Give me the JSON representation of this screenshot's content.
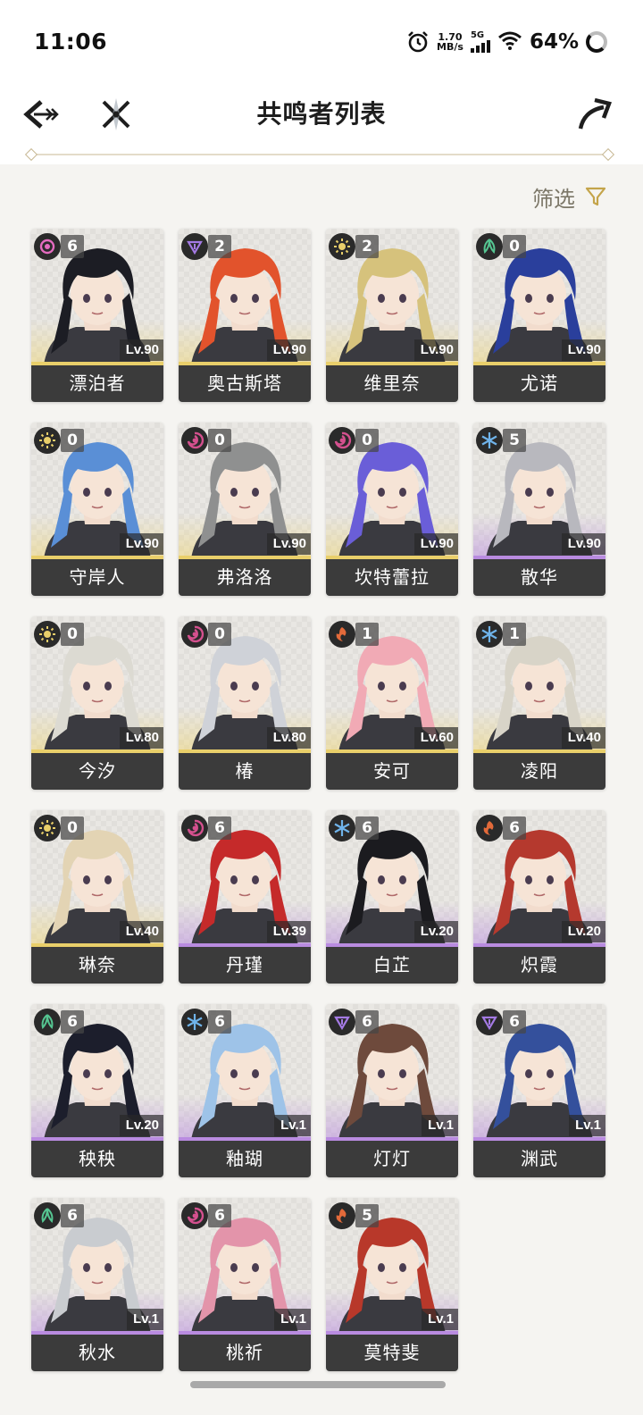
{
  "status_bar": {
    "time": "11:06",
    "net_speed_value": "1.70",
    "net_speed_unit": "MB/s",
    "network_type": "5G",
    "battery": "64%"
  },
  "header": {
    "title": "共鸣者列表"
  },
  "filter": {
    "label": "筛选"
  },
  "colors": {
    "gold_rarity": "#e9cf6a",
    "purple_rarity": "#b98be0",
    "name_bar": "#3b3b3b",
    "accent": "#c4a44a"
  },
  "characters": [
    {
      "name": "漂泊者",
      "level": "Lv.90",
      "chain": "6",
      "element": "spectro-havoc",
      "rarity": "gold",
      "hair": "#1c1d24"
    },
    {
      "name": "奥古斯塔",
      "level": "Lv.90",
      "chain": "2",
      "element": "electro",
      "rarity": "gold",
      "hair": "#e2532c"
    },
    {
      "name": "维里奈",
      "level": "Lv.90",
      "chain": "2",
      "element": "spectro",
      "rarity": "gold",
      "hair": "#d6c27c"
    },
    {
      "name": "尤诺",
      "level": "Lv.90",
      "chain": "0",
      "element": "aero",
      "rarity": "gold",
      "hair": "#2a3f9c"
    },
    {
      "name": "守岸人",
      "level": "Lv.90",
      "chain": "0",
      "element": "spectro",
      "rarity": "gold",
      "hair": "#5a8fd6"
    },
    {
      "name": "弗洛洛",
      "level": "Lv.90",
      "chain": "0",
      "element": "havoc",
      "rarity": "gold",
      "hair": "#8f9090"
    },
    {
      "name": "坎特蕾拉",
      "level": "Lv.90",
      "chain": "0",
      "element": "havoc",
      "rarity": "gold",
      "hair": "#6a5ed8"
    },
    {
      "name": "散华",
      "level": "Lv.90",
      "chain": "5",
      "element": "glacio",
      "rarity": "purple",
      "hair": "#b8b8be"
    },
    {
      "name": "今汐",
      "level": "Lv.80",
      "chain": "0",
      "element": "spectro",
      "rarity": "gold",
      "hair": "#dcdad2"
    },
    {
      "name": "椿",
      "level": "Lv.80",
      "chain": "0",
      "element": "havoc",
      "rarity": "gold",
      "hair": "#cfd2d8"
    },
    {
      "name": "安可",
      "level": "Lv.60",
      "chain": "1",
      "element": "fusion",
      "rarity": "gold",
      "hair": "#f1aab5"
    },
    {
      "name": "凌阳",
      "level": "Lv.40",
      "chain": "1",
      "element": "glacio",
      "rarity": "gold",
      "hair": "#d8d4c8"
    },
    {
      "name": "琳奈",
      "level": "Lv.40",
      "chain": "0",
      "element": "spectro",
      "rarity": "gold",
      "hair": "#e3d4b4"
    },
    {
      "name": "丹瑾",
      "level": "Lv.39",
      "chain": "6",
      "element": "havoc",
      "rarity": "purple",
      "hair": "#c52a2a"
    },
    {
      "name": "白芷",
      "level": "Lv.20",
      "chain": "6",
      "element": "glacio",
      "rarity": "purple",
      "hair": "#1b1b1f"
    },
    {
      "name": "炽霞",
      "level": "Lv.20",
      "chain": "6",
      "element": "fusion",
      "rarity": "purple",
      "hair": "#b5392e"
    },
    {
      "name": "秧秧",
      "level": "Lv.20",
      "chain": "6",
      "element": "aero",
      "rarity": "purple",
      "hair": "#1c1e2c"
    },
    {
      "name": "釉瑚",
      "level": "Lv.1",
      "chain": "6",
      "element": "glacio",
      "rarity": "purple",
      "hair": "#9ec3e8"
    },
    {
      "name": "灯灯",
      "level": "Lv.1",
      "chain": "6",
      "element": "electro",
      "rarity": "purple",
      "hair": "#6e4a3c"
    },
    {
      "name": "渊武",
      "level": "Lv.1",
      "chain": "6",
      "element": "electro",
      "rarity": "purple",
      "hair": "#34509c"
    },
    {
      "name": "秋水",
      "level": "Lv.1",
      "chain": "6",
      "element": "aero",
      "rarity": "purple",
      "hair": "#c9ccd0"
    },
    {
      "name": "桃祈",
      "level": "Lv.1",
      "chain": "6",
      "element": "havoc",
      "rarity": "purple",
      "hair": "#e394aa"
    },
    {
      "name": "莫特斐",
      "level": "Lv.1",
      "chain": "5",
      "element": "fusion",
      "rarity": "purple",
      "hair": "#b8382a"
    }
  ]
}
